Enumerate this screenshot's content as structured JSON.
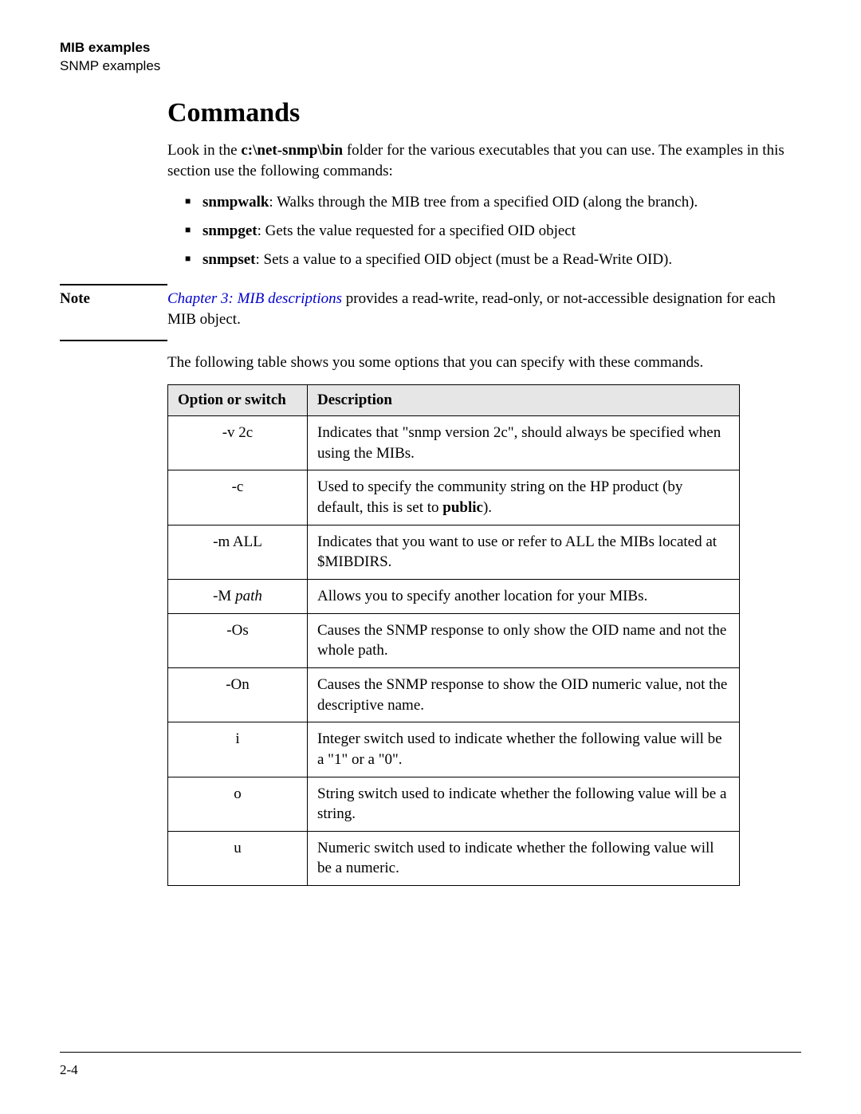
{
  "header": {
    "title": "MIB examples",
    "subtitle": "SNMP examples"
  },
  "heading": "Commands",
  "intro_prefix": "Look in the ",
  "intro_bold": "c:\\net-snmp\\bin",
  "intro_suffix": " folder for the various executables that you can use. The examples in this section use the following commands:",
  "commands": [
    {
      "name": "snmpwalk",
      "desc": ": Walks through the MIB tree from a specified OID (along the branch)."
    },
    {
      "name": "snmpget",
      "desc": ": Gets the value requested for a specified OID object"
    },
    {
      "name": "snmpset",
      "desc": ": Sets a value to a specified OID object (must be a Read-Write OID)."
    }
  ],
  "note": {
    "label": "Note",
    "link": "Chapter 3: MIB descriptions",
    "rest": " provides a read-write, read-only, or not-accessible designation for each MIB object."
  },
  "table_intro": "The following table shows you some options that you can specify with these commands.",
  "table": {
    "col1": "Option or switch",
    "col2": "Description",
    "rows": [
      {
        "opt": "-v 2c",
        "desc_pre": "Indicates that \"snmp version 2c\", should always be specified when using the MIBs.",
        "desc_bold": "",
        "desc_post": ""
      },
      {
        "opt": "-c",
        "desc_pre": "Used to specify the community string on the HP product (by default, this is set to ",
        "desc_bold": "public",
        "desc_post": ")."
      },
      {
        "opt": "-m ALL",
        "desc_pre": "Indicates that you want to use or refer to ALL the MIBs located at $MIBDIRS.",
        "desc_bold": "",
        "desc_post": ""
      },
      {
        "opt_pre": "-M  ",
        "opt_ital": "path",
        "desc_pre": "Allows you to specify another location for your MIBs.",
        "desc_bold": "",
        "desc_post": ""
      },
      {
        "opt": "-Os",
        "desc_pre": "Causes the SNMP response to only show the OID name and not the whole path.",
        "desc_bold": "",
        "desc_post": ""
      },
      {
        "opt": "-On",
        "desc_pre": "Causes the SNMP response to show the OID numeric value, not the descriptive name.",
        "desc_bold": "",
        "desc_post": ""
      },
      {
        "opt": "i",
        "desc_pre": "Integer switch used to indicate whether the following value will be a \"1\" or a \"0\".",
        "desc_bold": "",
        "desc_post": ""
      },
      {
        "opt": "o",
        "desc_pre": "String switch used to indicate whether the following value will be a string.",
        "desc_bold": "",
        "desc_post": ""
      },
      {
        "opt": "u",
        "desc_pre": "Numeric switch used to indicate whether the following value will be a numeric.",
        "desc_bold": "",
        "desc_post": ""
      }
    ]
  },
  "footer": "2-4"
}
